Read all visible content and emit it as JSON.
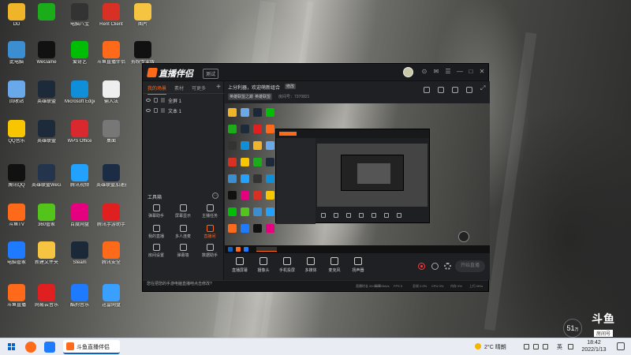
{
  "desktop": {
    "icons": [
      {
        "label": "DD",
        "color": "#f0b429"
      },
      {
        "label": "",
        "color": "#1aad19"
      },
      {
        "label": "电脑八宝",
        "color": "#333333"
      },
      {
        "label": "Rent Client",
        "color": "#d93025"
      },
      {
        "label": "图片",
        "color": "#f5c542"
      },
      {
        "label": "此电脑",
        "color": "#3b8ed0"
      },
      {
        "label": "WeGame",
        "color": "#111111"
      },
      {
        "label": "爱奇艺",
        "color": "#00be06"
      },
      {
        "label": "斗鱼直播伴侣",
        "color": "#ff6a1a"
      },
      {
        "label": "剪映专业版",
        "color": "#111111"
      },
      {
        "label": "回收站",
        "color": "#6aa9e9"
      },
      {
        "label": "英雄联盟",
        "color": "#1c2a3a"
      },
      {
        "label": "Microsoft Edge",
        "color": "#0f8fd8"
      },
      {
        "label": "输入法",
        "color": "#eeeeee"
      },
      {
        "label": "QQ音乐",
        "color": "#f7c600"
      },
      {
        "label": "英雄联盟",
        "color": "#1c2a3a"
      },
      {
        "label": "WPS Office",
        "color": "#d9292f"
      },
      {
        "label": "桌面",
        "color": "#777777"
      },
      {
        "label": "腾讯QQ",
        "color": "#111111"
      },
      {
        "label": "英雄联盟WeGame版",
        "color": "#24344d"
      },
      {
        "label": "腾讯视频",
        "color": "#22a1ff"
      },
      {
        "label": "英雄联盟加速器",
        "color": "#1b2c44"
      },
      {
        "label": "斗鱼TV",
        "color": "#ff6a1a"
      },
      {
        "label": "360管家",
        "color": "#52c41a"
      },
      {
        "label": "百度网盘",
        "color": "#e4007f"
      },
      {
        "label": "腾讯手游助手",
        "color": "#e02020"
      },
      {
        "label": "电脑管家",
        "color": "#1e7bff"
      },
      {
        "label": "新建文件夹",
        "color": "#f5c542"
      },
      {
        "label": "Steam",
        "color": "#1b2838"
      },
      {
        "label": "腾讯安全",
        "color": "#ff6a1a"
      },
      {
        "label": "斗鱼直播",
        "color": "#ff6a1a"
      },
      {
        "label": "网易云音乐",
        "color": "#e02020"
      },
      {
        "label": "酷狗音乐",
        "color": "#1e7bff"
      },
      {
        "label": "迅雷网盘",
        "color": "#3aa0ff"
      }
    ]
  },
  "app": {
    "title": "直播伴侣",
    "version": "测试",
    "titlebar_buttons": [
      "⊙",
      "✉",
      "☰",
      "—",
      "□",
      "✕"
    ],
    "left_tabs": [
      "我的场景",
      "素材",
      "可更多"
    ],
    "add_symbol": "+",
    "scenes": [
      "全屏 1",
      "文本 1"
    ],
    "tools_title": "工具箱",
    "tools_more": "···",
    "tools": [
      {
        "label": "弹幕助手",
        "hot": false
      },
      {
        "label": "屏幕显示",
        "hot": false
      },
      {
        "label": "主播任务",
        "hot": false
      },
      {
        "label": "我的直播",
        "hot": false
      },
      {
        "label": "多人连麦",
        "hot": false
      },
      {
        "label": "直播间",
        "hot": true
      },
      {
        "label": "房间设置",
        "hot": false
      },
      {
        "label": "弹幕墙",
        "hot": false
      },
      {
        "label": "数据助手",
        "hot": false
      }
    ],
    "notice": "您在把您的手游电脑直播吧点击修改?",
    "room": {
      "title": "上分利器，欢迎萌新组合",
      "edit_label": "修改",
      "tags": [
        "英雄联盟之巅",
        "英雄联盟"
      ],
      "room_id": "房间号：7370821"
    },
    "controls": [
      {
        "label": "直播屏幕",
        "icon": "screen-icon"
      },
      {
        "label": "摄像头",
        "icon": "camera-icon"
      },
      {
        "label": "手机投屏",
        "icon": "phone-icon"
      },
      {
        "label": "多媒体",
        "icon": "media-icon"
      },
      {
        "label": "麦克风",
        "icon": "mic-icon"
      },
      {
        "label": "扬声器",
        "icon": "speaker-icon"
      }
    ],
    "start_button": "开始直播",
    "status": [
      "直播时长 00:00:00",
      "码率 0kb/s",
      "FPS 0",
      "丢帧 0.0%",
      "CPU 0%",
      "内存 0%",
      "上行 0K/s"
    ]
  },
  "overlay": {
    "viewer_count": "51",
    "viewer_suffix": "万",
    "watermark_logo": "斗鱼",
    "watermark_room": "房间号"
  },
  "taskbar": {
    "active_app": "斗鱼直播伴侣",
    "weather": "2°C 晴朗",
    "ime": "英",
    "time": "18:42",
    "date": "2022/1/13"
  },
  "colors": {
    "accent": "#ff6a1a",
    "window_bg": "#1f2023",
    "taskbar_bg": "#e9edf3"
  }
}
